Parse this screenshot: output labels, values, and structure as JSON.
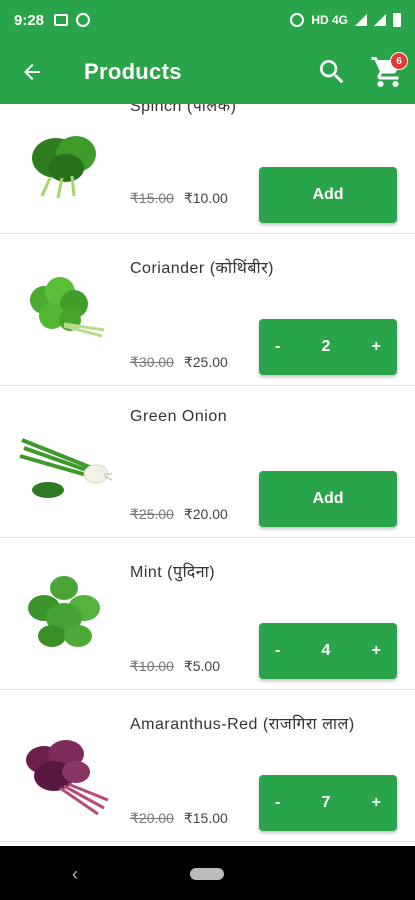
{
  "status_bar": {
    "time": "9:28",
    "network": "HD 4G"
  },
  "app_bar": {
    "title": "Products",
    "cart_count": "6"
  },
  "products": [
    {
      "name": "Spinch (पालक)",
      "old_price": "₹15.00",
      "price": "₹10.00",
      "action": "Add"
    },
    {
      "name": "Coriander (कोथिंबीर)",
      "old_price": "₹30.00",
      "price": "₹25.00",
      "quantity": "2",
      "minus": "-",
      "plus": "+"
    },
    {
      "name": "Green Onion",
      "old_price": "₹25.00",
      "price": "₹20.00",
      "action": "Add"
    },
    {
      "name": "Mint (पुदिना)",
      "old_price": "₹10.00",
      "price": "₹5.00",
      "quantity": "4",
      "minus": "-",
      "plus": "+"
    },
    {
      "name": "Amaranthus-Red (राजगिरा लाल)",
      "old_price": "₹20.00",
      "price": "₹15.00",
      "quantity": "7",
      "minus": "-",
      "plus": "+"
    }
  ],
  "colors": {
    "primary": "#2aa44a",
    "badge": "#e53935"
  }
}
